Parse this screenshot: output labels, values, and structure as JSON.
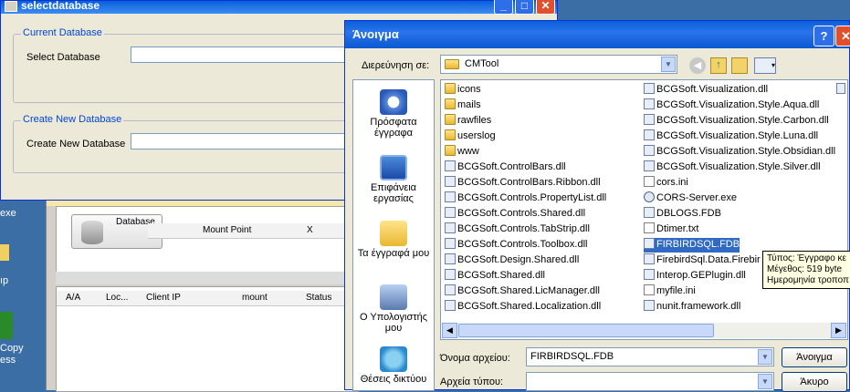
{
  "select_window": {
    "title": "selectdatabase",
    "current_group": "Current Database",
    "select_label": "Select Database",
    "create_group": "Create New Database",
    "create_label": "Create  New Database"
  },
  "background_app": {
    "db_button": "Database",
    "columns_top": [
      "Mount Point",
      "X"
    ],
    "columns_bottom": [
      "A/A",
      "Loc...",
      "Client IP",
      "mount",
      "Status"
    ]
  },
  "desktop": {
    "labels": [
      "exe",
      "ıp",
      "Copy",
      "ess"
    ]
  },
  "dialog": {
    "title": "Άνοιγμα",
    "lookin_label": "Διερεύνηση σε:",
    "lookin_value": "CMTool",
    "places": [
      {
        "label": "Πρόσφατα έγγραφα",
        "icon": "recent-documents-icon"
      },
      {
        "label": "Επιφάνεια εργασίας",
        "icon": "desktop-icon"
      },
      {
        "label": "Τα έγγραφά μου",
        "icon": "my-documents-icon"
      },
      {
        "label": "Ο Υπολογιστής μου",
        "icon": "my-computer-icon"
      },
      {
        "label": "Θέσεις δικτύου",
        "icon": "network-places-icon"
      }
    ],
    "files_col1": [
      {
        "name": "icons",
        "type": "folder"
      },
      {
        "name": "mails",
        "type": "folder"
      },
      {
        "name": "rawfiles",
        "type": "folder"
      },
      {
        "name": "userslog",
        "type": "folder"
      },
      {
        "name": "www",
        "type": "folder"
      },
      {
        "name": "BCGSoft.ControlBars.dll",
        "type": "dll"
      },
      {
        "name": "BCGSoft.ControlBars.Ribbon.dll",
        "type": "dll"
      },
      {
        "name": "BCGSoft.Controls.PropertyList.dll",
        "type": "dll"
      },
      {
        "name": "BCGSoft.Controls.Shared.dll",
        "type": "dll"
      },
      {
        "name": "BCGSoft.Controls.TabStrip.dll",
        "type": "dll"
      },
      {
        "name": "BCGSoft.Controls.Toolbox.dll",
        "type": "dll"
      },
      {
        "name": "BCGSoft.Design.Shared.dll",
        "type": "dll"
      },
      {
        "name": "BCGSoft.Shared.dll",
        "type": "dll"
      },
      {
        "name": "BCGSoft.Shared.LicManager.dll",
        "type": "dll"
      },
      {
        "name": "BCGSoft.Shared.Localization.dll",
        "type": "dll"
      }
    ],
    "files_col2": [
      {
        "name": "BCGSoft.Visualization.dll",
        "type": "dll"
      },
      {
        "name": "BCGSoft.Visualization.Style.Aqua.dll",
        "type": "dll"
      },
      {
        "name": "BCGSoft.Visualization.Style.Carbon.dll",
        "type": "dll"
      },
      {
        "name": "BCGSoft.Visualization.Style.Luna.dll",
        "type": "dll"
      },
      {
        "name": "BCGSoft.Visualization.Style.Obsidian.dll",
        "type": "dll"
      },
      {
        "name": "BCGSoft.Visualization.Style.Silver.dll",
        "type": "dll"
      },
      {
        "name": "cors.ini",
        "type": "ini"
      },
      {
        "name": "CORS-Server.exe",
        "type": "exe"
      },
      {
        "name": "DBLOGS.FDB",
        "type": "dll"
      },
      {
        "name": "Dtimer.txt",
        "type": "ini"
      },
      {
        "name": "FIRBIRDSQL.FDB",
        "type": "dll",
        "selected": true
      },
      {
        "name": "FirebirdSql.Data.Firebir",
        "type": "dll"
      },
      {
        "name": "Interop.GEPlugin.dll",
        "type": "dll"
      },
      {
        "name": "myfile.ini",
        "type": "ini"
      },
      {
        "name": "nunit.framework.dll",
        "type": "dll"
      }
    ],
    "tooltip": [
      "Τύπος: Έγγραφο κε",
      "Μέγεθος: 519 byte",
      "Ημερομηνία τροποπ"
    ],
    "filename_label": "Όνομα αρχείου:",
    "filename_value": "FIRBIRDSQL.FDB",
    "filetype_label": "Αρχεία τύπου:",
    "filetype_value": "",
    "open_button": "Άνοιγμα",
    "cancel_button": "Άκυρο"
  }
}
